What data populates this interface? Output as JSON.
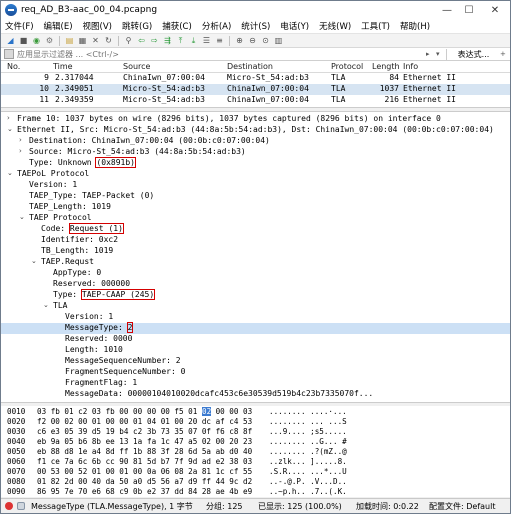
{
  "window": {
    "title": "req_AD_B3-aac_00_04.pcapng"
  },
  "menu": [
    "文件(F)",
    "编辑(E)",
    "视图(V)",
    "跳转(G)",
    "捕获(C)",
    "分析(A)",
    "统计(S)",
    "电话(Y)",
    "无线(W)",
    "工具(T)",
    "帮助(H)"
  ],
  "filter": {
    "placeholder": "应用显示过滤器 ... <Ctrl-/>",
    "button": "表达式..."
  },
  "packet_list": {
    "columns": [
      "No.",
      "Time",
      "Source",
      "Destination",
      "Protocol",
      "Length",
      "Info"
    ],
    "rows": [
      {
        "no": "9",
        "time": "2.317044",
        "src": "ChinaIwn_07:00:04",
        "dst": "Micro-St_54:ad:b3",
        "proto": "TLA",
        "len": "84",
        "info": "Ethernet II"
      },
      {
        "no": "10",
        "time": "2.349051",
        "src": "Micro-St_54:ad:b3",
        "dst": "ChinaIwn_07:00:04",
        "proto": "TLA",
        "len": "1037",
        "info": "Ethernet II"
      },
      {
        "no": "11",
        "time": "2.349359",
        "src": "Micro-St_54:ad:b3",
        "dst": "ChinaIwn_07:00:04",
        "proto": "TLA",
        "len": "216",
        "info": "Ethernet II"
      }
    ]
  },
  "details": [
    {
      "tw": "›",
      "indent": 0,
      "text": "Frame 10: 1037 bytes on wire (8296 bits), 1037 bytes captured (8296 bits) on interface 0"
    },
    {
      "tw": "⌄",
      "indent": 0,
      "text": "Ethernet II, Src: Micro-St_54:ad:b3 (44:8a:5b:54:ad:b3), Dst: ChinaIwn_07:00:04 (00:0b:c0:07:00:04)"
    },
    {
      "tw": "›",
      "indent": 1,
      "text": "Destination: ChinaIwn_07:00:04 (00:0b:c0:07:00:04)"
    },
    {
      "tw": "›",
      "indent": 1,
      "text": "Source: Micro-St_54:ad:b3 (44:8a:5b:54:ad:b3)"
    },
    {
      "tw": "",
      "indent": 1,
      "text": "Type: Unknown ",
      "hl": "(0x891b)"
    },
    {
      "tw": "⌄",
      "indent": 0,
      "text": "TAEPoL Protocol"
    },
    {
      "tw": "",
      "indent": 1,
      "text": "Version: 1"
    },
    {
      "tw": "",
      "indent": 1,
      "text": "TAEP_Type: TAEP-Packet (0)"
    },
    {
      "tw": "",
      "indent": 1,
      "text": "TAEP_Length: 1019"
    },
    {
      "tw": "⌄",
      "indent": 1,
      "text": "TAEP Protocol"
    },
    {
      "tw": "",
      "indent": 2,
      "text": "Code: ",
      "hl": "Request (1)"
    },
    {
      "tw": "",
      "indent": 2,
      "text": "Identifier: 0xc2"
    },
    {
      "tw": "",
      "indent": 2,
      "text": "TB_Length: 1019"
    },
    {
      "tw": "⌄",
      "indent": 2,
      "text": "TAEP.Requst"
    },
    {
      "tw": "",
      "indent": 3,
      "text": "AppType: 0"
    },
    {
      "tw": "",
      "indent": 3,
      "text": "Reserved: 000000"
    },
    {
      "tw": "",
      "indent": 3,
      "text": "Type: ",
      "hl": "TAEP-CAAP (245)"
    },
    {
      "tw": "⌄",
      "indent": 3,
      "text": "TLA"
    },
    {
      "tw": "",
      "indent": 4,
      "text": "Version: 1"
    },
    {
      "tw": "",
      "indent": 4,
      "text": "MessageType: ",
      "hl": "2",
      "sel": true
    },
    {
      "tw": "",
      "indent": 4,
      "text": "Reserved: 0000"
    },
    {
      "tw": "",
      "indent": 4,
      "text": "Length: 1010"
    },
    {
      "tw": "",
      "indent": 4,
      "text": "MessageSequenceNumber: 2"
    },
    {
      "tw": "",
      "indent": 4,
      "text": "FragmentSequenceNumber: 0"
    },
    {
      "tw": "",
      "indent": 4,
      "text": "FragmentFlag: 1"
    },
    {
      "tw": "",
      "indent": 4,
      "text": "MessageData: 00000104010020dcafc453c6e30539d519b4c23b7335070f..."
    }
  ],
  "hex": [
    {
      "off": "0010",
      "b1": "03 fb 01 c2 03 fb 00 00",
      "b2": "00 00 f5 01 ",
      "sel": "02",
      "b3": " 00 00 03",
      "ascii": "........ ....·..."
    },
    {
      "off": "0020",
      "b1": "f2 00 02 00 01 00 00 01",
      "b2": "04 01 00 20 dc af c4 53",
      "sel": "",
      "b3": "",
      "ascii": "........ ... ...S"
    },
    {
      "off": "0030",
      "b1": "c6 e3 05 39 d5 19 b4 c2",
      "b2": "3b 73 35 07 0f f6 c8 8f",
      "sel": "",
      "b3": "",
      "ascii": "...9.... ;s5....."
    },
    {
      "off": "0040",
      "b1": "eb 9a 05 b6 8b ee 13 1a",
      "b2": "fa 1c 47 a5 02 00 20 23",
      "sel": "",
      "b3": "",
      "ascii": "........ ..G... #"
    },
    {
      "off": "0050",
      "b1": "eb 88 d8 1e a4 8d ff 1b",
      "b2": "88 3f 28 6d 5a ab d0 40",
      "sel": "",
      "b3": "",
      "ascii": "........ .?(mZ..@"
    },
    {
      "off": "0060",
      "b1": "f1 ce 7a 6c 6b cc 90 81",
      "b2": "5d b7 7f 9d ad e2 38 03",
      "sel": "",
      "b3": "",
      "ascii": "..zlk... ].....8."
    },
    {
      "off": "0070",
      "b1": "00 53 00 52 01 00 01 00",
      "b2": "0a 06 08 2a 81 1c cf 55",
      "sel": "",
      "b3": "",
      "ascii": ".S.R.... ...*...U"
    },
    {
      "off": "0080",
      "b1": "01 82 2d 00 40 da 50 a0",
      "b2": "d5 56 a7 d9 ff 44 9c d2",
      "sel": "",
      "b3": "",
      "ascii": "..-.@.P. .V...D.."
    },
    {
      "off": "0090",
      "b1": "86 95 7e 70 e6 68 c9 0b",
      "b2": "e2 37 dd 84 28 ae 4b e9",
      "sel": "",
      "b3": "",
      "ascii": "..~p.h.. .7..(.K."
    }
  ],
  "status": {
    "field": "MessageType (TLA.MessageType), 1 字节",
    "packets": "分组: 125",
    "displayed": "已显示: 125 (100.0%)",
    "load": "加载时间: 0:0.22",
    "profile": "配置文件: Default"
  }
}
